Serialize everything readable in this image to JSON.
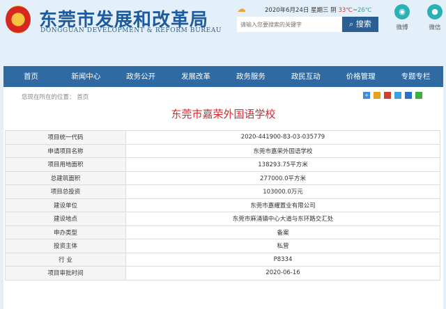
{
  "header": {
    "title": "东莞市发展和改革局",
    "subtitle": "DONGGUAN DEVELOPMENT & REFORM BUREAU",
    "date": "2020年6月24日 星期三",
    "weather": "阴",
    "high": "33℃",
    "sep": "~",
    "low": "26℃",
    "search_placeholder": "请输入您要搜索的关键字",
    "search_button": "搜索",
    "weibo": "微博",
    "weixin": "微信"
  },
  "nav": [
    "首页",
    "新闻中心",
    "政务公开",
    "发展改革",
    "政务服务",
    "政民互动",
    "价格管理",
    "专题专栏"
  ],
  "breadcrumb": {
    "label": "您现在所在的位置：",
    "home": "首页"
  },
  "page_title": "东莞市嘉荣外国语学校",
  "rows": [
    {
      "k": "项目统一代码",
      "v": "2020-441900-83-03-035779"
    },
    {
      "k": "申请项目名称",
      "v": "东莞市嘉荣外国语学校"
    },
    {
      "k": "项目用地面积",
      "v": "138293.75平方米"
    },
    {
      "k": "总建筑面积",
      "v": "277000.0平方米"
    },
    {
      "k": "项目总投资",
      "v": "103000.0万元"
    },
    {
      "k": "建设单位",
      "v": "东莞市嘉耀置业有限公司"
    },
    {
      "k": "建设地点",
      "v": "东莞市麻涌镇中心大道与东环路交汇处"
    },
    {
      "k": "申办类型",
      "v": "备案"
    },
    {
      "k": "投资主体",
      "v": "私营"
    },
    {
      "k": "行 业",
      "v": "P8334"
    },
    {
      "k": "项目审批时间",
      "v": "2020-06-16"
    }
  ]
}
